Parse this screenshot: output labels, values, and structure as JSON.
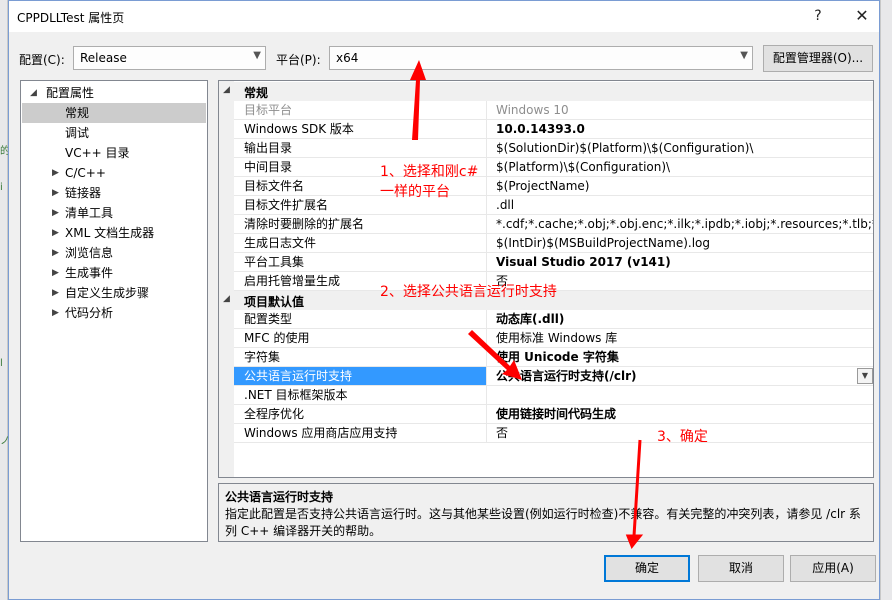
{
  "window": {
    "title": "CPPDLLTest 属性页",
    "help_glyph": "?",
    "close_glyph": "✕"
  },
  "toolbar": {
    "config_label": "配置(C):",
    "config_value": "Release",
    "platform_label": "平台(P):",
    "platform_value": "x64",
    "config_manager_label": "配置管理器(O)..."
  },
  "tree": {
    "root": "配置属性",
    "items": [
      {
        "label": "常规",
        "expandable": false,
        "selected": true
      },
      {
        "label": "调试",
        "expandable": false
      },
      {
        "label": "VC++ 目录",
        "expandable": false
      },
      {
        "label": "C/C++",
        "expandable": true
      },
      {
        "label": "链接器",
        "expandable": true
      },
      {
        "label": "清单工具",
        "expandable": true
      },
      {
        "label": "XML 文档生成器",
        "expandable": true
      },
      {
        "label": "浏览信息",
        "expandable": true
      },
      {
        "label": "生成事件",
        "expandable": true
      },
      {
        "label": "自定义生成步骤",
        "expandable": true
      },
      {
        "label": "代码分析",
        "expandable": true
      }
    ]
  },
  "grid": {
    "category_general": "常规",
    "general_rows": [
      {
        "name": "目标平台",
        "value": "Windows 10",
        "gray": true
      },
      {
        "name": "Windows SDK 版本",
        "value": "10.0.14393.0",
        "bold": true
      },
      {
        "name": "输出目录",
        "value": "$(SolutionDir)$(Platform)\\$(Configuration)\\"
      },
      {
        "name": "中间目录",
        "value": "$(Platform)\\$(Configuration)\\"
      },
      {
        "name": "目标文件名",
        "value": "$(ProjectName)"
      },
      {
        "name": "目标文件扩展名",
        "value": ".dll"
      },
      {
        "name": "清除时要删除的扩展名",
        "value": "*.cdf;*.cache;*.obj;*.obj.enc;*.ilk;*.ipdb;*.iobj;*.resources;*.tlb;*.tli;*.t"
      },
      {
        "name": "生成日志文件",
        "value": "$(IntDir)$(MSBuildProjectName).log"
      },
      {
        "name": "平台工具集",
        "value": "Visual Studio 2017 (v141)",
        "bold": true
      },
      {
        "name": "启用托管增量生成",
        "value": "否"
      }
    ],
    "category_defaults": "项目默认值",
    "default_rows": [
      {
        "name": "配置类型",
        "value": "动态库(.dll)",
        "bold": true
      },
      {
        "name": "MFC 的使用",
        "value": "使用标准 Windows 库"
      },
      {
        "name": "字符集",
        "value": "使用 Unicode 字符集",
        "bold": true
      },
      {
        "name": "公共语言运行时支持",
        "value": "公共语言运行时支持(/clr)",
        "selected": true
      },
      {
        "name": ".NET 目标框架版本",
        "value": ""
      },
      {
        "name": "全程序优化",
        "value": "使用链接时间代码生成",
        "bold": true
      },
      {
        "name": "Windows 应用商店应用支持",
        "value": "否"
      }
    ]
  },
  "description": {
    "title": "公共语言运行时支持",
    "text": "指定此配置是否支持公共语言运行时。这与其他某些设置(例如运行时检查)不兼容。有关完整的冲突列表，请参见 /clr 系列 C++ 编译器开关的帮助。"
  },
  "buttons": {
    "ok": "确定",
    "cancel": "取消",
    "apply": "应用(A)"
  },
  "annotations": {
    "step1_line1": "1、选择和刚c#",
    "step1_line2": "一样的平台",
    "step2": "2、选择公共语言运行时支持",
    "step3": "3、确定",
    "color": "#ff0000"
  }
}
